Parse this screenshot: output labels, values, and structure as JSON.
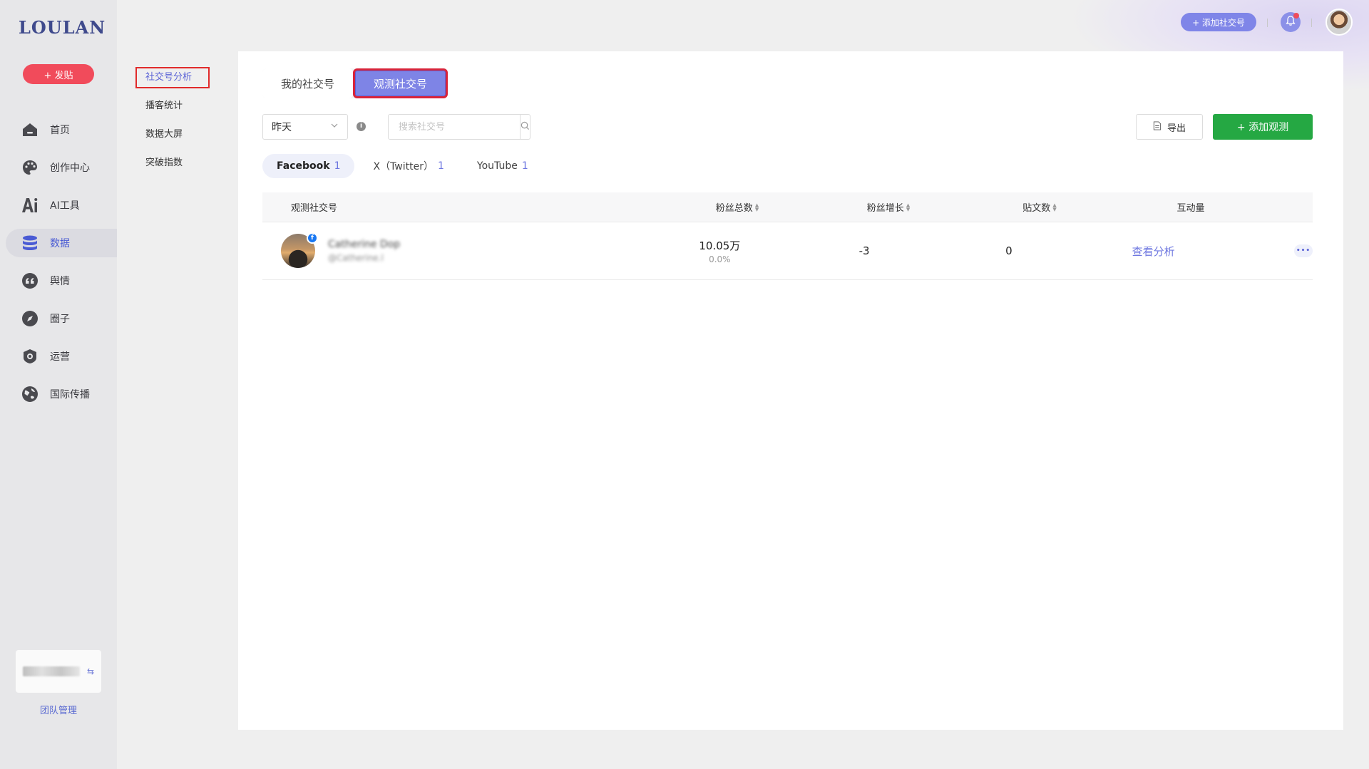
{
  "brand": {
    "logo": "LOULAN"
  },
  "sidebar": {
    "post_button": "+ 发贴",
    "items": [
      {
        "label": "首页",
        "icon": "home-icon"
      },
      {
        "label": "创作中心",
        "icon": "palette-icon"
      },
      {
        "label": "AI工具",
        "icon": "ai-icon"
      },
      {
        "label": "数据",
        "icon": "database-icon"
      },
      {
        "label": "舆情",
        "icon": "quote-icon"
      },
      {
        "label": "圈子",
        "icon": "compass-icon"
      },
      {
        "label": "运营",
        "icon": "operation-icon"
      },
      {
        "label": "国际传播",
        "icon": "globe-icon"
      }
    ],
    "team_switch_icon": "swap-icon",
    "team_manage": "团队管理"
  },
  "subnav": {
    "items": [
      "社交号分析",
      "播客统计",
      "数据大屏",
      "突破指数"
    ]
  },
  "topbar": {
    "add_social": "+ 添加社交号"
  },
  "tabs": [
    "我的社交号",
    "观测社交号"
  ],
  "filters": {
    "date": "昨天",
    "search_placeholder": "搜索社交号",
    "export": "导出",
    "add_watch": "+ 添加观测"
  },
  "platforms": [
    {
      "name": "Facebook",
      "count": "1"
    },
    {
      "name": "X（Twitter）",
      "count": "1"
    },
    {
      "name": "YouTube",
      "count": "1"
    }
  ],
  "table": {
    "headers": [
      "观测社交号",
      "粉丝总数",
      "粉丝增长",
      "贴文数",
      "互动量"
    ],
    "rows": [
      {
        "name": "Catherine Dop",
        "handle": "@Catherine.l",
        "fans": "10.05万",
        "fans_pct": "0.0%",
        "growth": "-3",
        "posts": "0",
        "action": "查看分析",
        "more": "•••"
      }
    ]
  },
  "colors": {
    "accent": "#7e84e6",
    "post_red": "#f14b5b",
    "add_green": "#25a843",
    "highlight_border": "#e02a2a"
  }
}
